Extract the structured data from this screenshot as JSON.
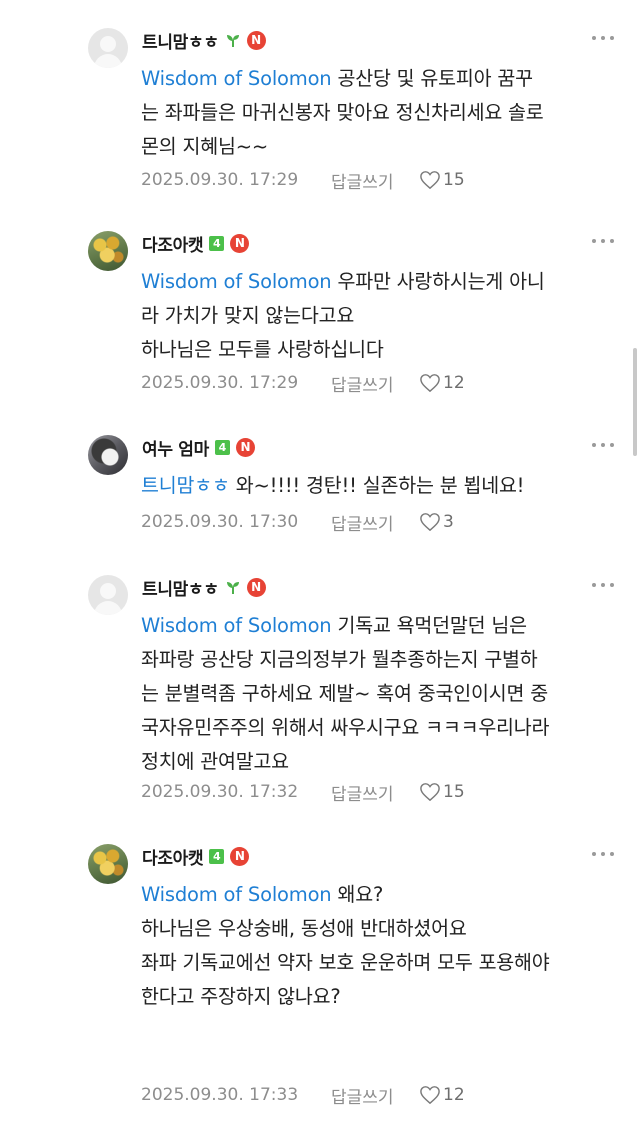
{
  "comments": [
    {
      "author": "트니맘ㅎㅎ",
      "badge": "sprout-icon",
      "avatar": "default-avatar",
      "lines": [
        {
          "mention": "Wisdom of Solomon",
          "text": " 공산당 및 유토피아 꿈꾸"
        },
        {
          "mention": "",
          "text": "는 좌파들은 마귀신봉자 맞아요 정신차리세요 솔로"
        },
        {
          "mention": "",
          "text": "몬의 지혜님~~"
        }
      ],
      "date": "2025.09.30. 17:29",
      "reply": "답글쓰기",
      "likes": "15"
    },
    {
      "author": "다조아캣",
      "badge": "4",
      "avatar": "flowers-avatar",
      "lines": [
        {
          "mention": "Wisdom of Solomon",
          "text": " 우파만 사랑하시는게 아니"
        },
        {
          "mention": "",
          "text": "라 가치가 맞지 않는다고요"
        },
        {
          "mention": "",
          "text": "하나님은 모두를 사랑하십니다"
        }
      ],
      "date": "2025.09.30. 17:29",
      "reply": "답글쓰기",
      "likes": "12"
    },
    {
      "author": "여누 엄마",
      "badge": "4",
      "avatar": "cat-avatar",
      "lines": [
        {
          "mention": "트니맘ㅎㅎ",
          "text": " 와~!!!! 경탄!! 실존하는 분 뵙네요!"
        }
      ],
      "date": "2025.09.30. 17:30",
      "reply": "답글쓰기",
      "likes": "3"
    },
    {
      "author": "트니맘ㅎㅎ",
      "badge": "sprout-icon",
      "avatar": "default-avatar",
      "lines": [
        {
          "mention": "Wisdom of Solomon",
          "text": " 기독교 욕먹던말던 님은"
        },
        {
          "mention": "",
          "text": "좌파랑 공산당 지금의정부가 뭘추종하는지 구별하"
        },
        {
          "mention": "",
          "text": "는 분별력좀 구하세요 제발~ 혹여 중국인이시면 중"
        },
        {
          "mention": "",
          "text": "국자유민주주의 위해서 싸우시구요 ㅋㅋㅋ우리나라"
        },
        {
          "mention": "",
          "text": "정치에 관여말고요"
        }
      ],
      "date": "2025.09.30. 17:32",
      "reply": "답글쓰기",
      "likes": "15"
    },
    {
      "author": "다조아캣",
      "badge": "4",
      "avatar": "flowers-avatar",
      "lines": [
        {
          "mention": "Wisdom of Solomon",
          "text": " 왜요?"
        },
        {
          "mention": "",
          "text": "하나님은 우상숭배, 동성애 반대하셨어요"
        },
        {
          "mention": "",
          "text": "좌파 기독교에선 약자 보호 운운하며 모두 포용해야"
        },
        {
          "mention": "",
          "text": "한다고 주장하지 않나요?"
        }
      ],
      "date": "2025.09.30. 17:33",
      "reply": "답글쓰기",
      "likes": "12"
    }
  ],
  "new_badge": "N",
  "icons": {
    "more": "more-dots-icon",
    "like": "heart-icon"
  },
  "colors": {
    "mention": "#1f7fd4",
    "new_badge": "#e74335",
    "level_badge": "#4cc04a",
    "meta_text": "#8d8d8d"
  }
}
